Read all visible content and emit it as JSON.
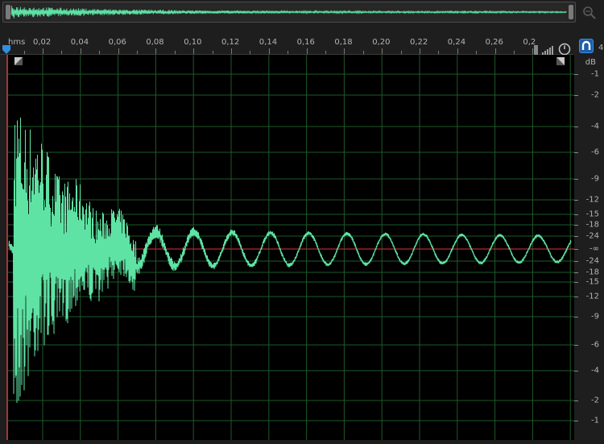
{
  "ruler": {
    "unit_label": "hms",
    "ticks": [
      "0,02",
      "0,04",
      "0,06",
      "0,08",
      "0,10",
      "0,12",
      "0,14",
      "0,16",
      "0,18",
      "0,20",
      "0,22",
      "0,24",
      "0,26",
      "0,2"
    ],
    "corner_label": "4"
  },
  "db_scale": {
    "unit": "dB",
    "labels_top": [
      "-1",
      "-2",
      "-4",
      "-6",
      "-9",
      "-12",
      "-15",
      "-18",
      "-24",
      "-∞"
    ],
    "labels_bottom": [
      "-24",
      "-18",
      "-15",
      "-12",
      "-9",
      "-6",
      "-4",
      "-2",
      "-1"
    ]
  },
  "colors": {
    "waveform": "#5fe3a4",
    "grid": "#1d5a2a",
    "center_line": "#b02a2a",
    "background": "#000000",
    "accent": "#2f8fe0"
  },
  "icons": {
    "zoom": "zoom-magnifier-icon",
    "playhead": "playhead-marker-icon",
    "level": "level-bars-icon",
    "clock": "clock-icon",
    "magnet": "snap-magnet-icon"
  }
}
